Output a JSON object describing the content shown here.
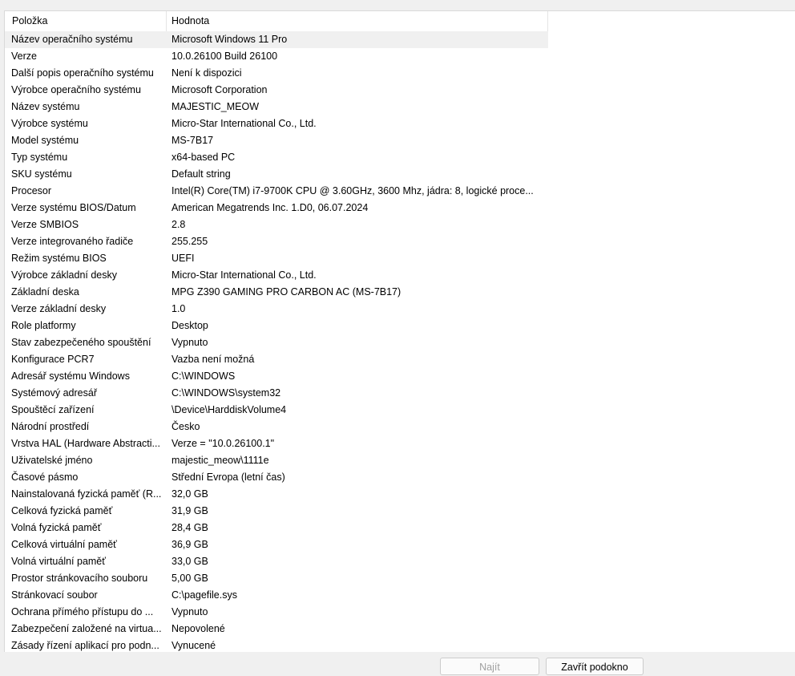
{
  "columns": {
    "item": "Položka",
    "value": "Hodnota"
  },
  "rows": [
    {
      "item": "Název operačního systému",
      "value": "Microsoft Windows 11 Pro"
    },
    {
      "item": "Verze",
      "value": "10.0.26100 Build 26100"
    },
    {
      "item": "Další popis operačního systému",
      "value": "Není k dispozici"
    },
    {
      "item": "Výrobce operačního systému",
      "value": "Microsoft Corporation"
    },
    {
      "item": "Název systému",
      "value": "MAJESTIC_MEOW"
    },
    {
      "item": "Výrobce systému",
      "value": "Micro-Star International Co., Ltd."
    },
    {
      "item": "Model systému",
      "value": "MS-7B17"
    },
    {
      "item": "Typ systému",
      "value": "x64-based PC"
    },
    {
      "item": "SKU systému",
      "value": "Default string"
    },
    {
      "item": "Procesor",
      "value": "Intel(R) Core(TM) i7-9700K CPU @ 3.60GHz, 3600 Mhz, jádra: 8, logické proce..."
    },
    {
      "item": "Verze systému BIOS/Datum",
      "value": "American Megatrends Inc. 1.D0, 06.07.2024"
    },
    {
      "item": "Verze SMBIOS",
      "value": "2.8"
    },
    {
      "item": "Verze integrovaného řadiče",
      "value": "255.255"
    },
    {
      "item": "Režim systému BIOS",
      "value": "UEFI"
    },
    {
      "item": "Výrobce základní desky",
      "value": "Micro-Star International Co., Ltd."
    },
    {
      "item": "Základní deska",
      "value": "MPG Z390 GAMING PRO CARBON AC (MS-7B17)"
    },
    {
      "item": "Verze základní desky",
      "value": "1.0"
    },
    {
      "item": "Role platformy",
      "value": "Desktop"
    },
    {
      "item": "Stav zabezpečeného spouštění",
      "value": "Vypnuto"
    },
    {
      "item": "Konfigurace PCR7",
      "value": "Vazba není možná"
    },
    {
      "item": "Adresář systému Windows",
      "value": "C:\\WINDOWS"
    },
    {
      "item": "Systémový adresář",
      "value": "C:\\WINDOWS\\system32"
    },
    {
      "item": "Spouštěcí zařízení",
      "value": "\\Device\\HarddiskVolume4"
    },
    {
      "item": "Národní prostředí",
      "value": "Česko"
    },
    {
      "item": "Vrstva HAL (Hardware Abstracti...",
      "value": "Verze = \"10.0.26100.1\""
    },
    {
      "item": "Uživatelské jméno",
      "value": "majestic_meow\\1111e"
    },
    {
      "item": "Časové pásmo",
      "value": "Střední Evropa (letní čas)"
    },
    {
      "item": "Nainstalovaná fyzická paměť (R...",
      "value": "32,0 GB"
    },
    {
      "item": "Celková fyzická paměť",
      "value": "31,9 GB"
    },
    {
      "item": "Volná fyzická paměť",
      "value": "28,4 GB"
    },
    {
      "item": "Celková virtuální paměť",
      "value": "36,9 GB"
    },
    {
      "item": "Volná virtuální paměť",
      "value": "33,0 GB"
    },
    {
      "item": "Prostor stránkovacího souboru",
      "value": "5,00 GB"
    },
    {
      "item": "Stránkovací soubor",
      "value": "C:\\pagefile.sys"
    },
    {
      "item": "Ochrana přímého přístupu do ...",
      "value": "Vypnuto"
    },
    {
      "item": "Zabezpečení založené na virtua...",
      "value": "Nepovolené"
    },
    {
      "item": "Zásady řízení aplikací pro podn...",
      "value": "Vynucené"
    }
  ],
  "buttons": {
    "find": "Najít",
    "close": "Zavřít podokno"
  }
}
